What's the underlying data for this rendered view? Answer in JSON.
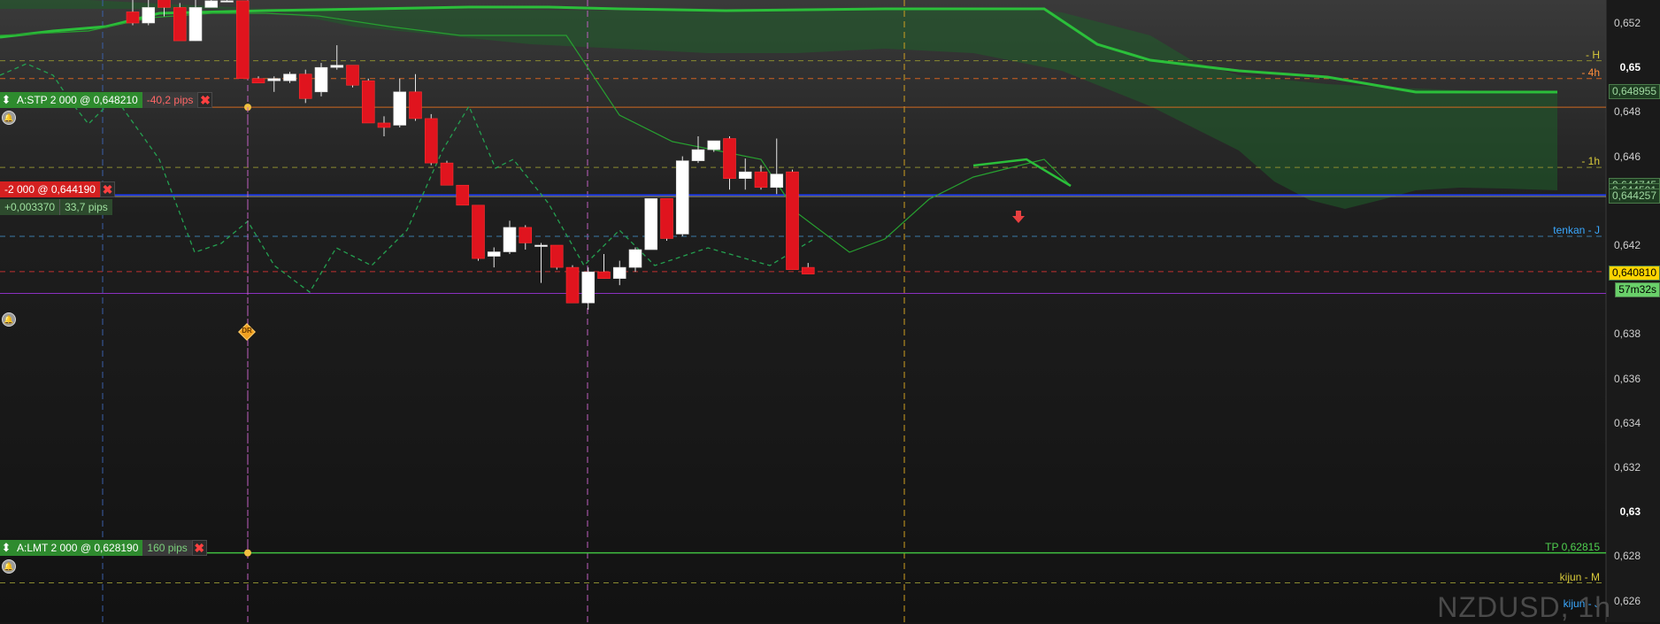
{
  "symbol_watermark": "NZDUSD, 1h",
  "price_axis": {
    "labels": [
      {
        "value": "0,652",
        "price": 0.652,
        "bold": false
      },
      {
        "value": "0,65",
        "price": 0.65,
        "bold": true
      },
      {
        "value": "0,648",
        "price": 0.648,
        "bold": false
      },
      {
        "value": "0,646",
        "price": 0.646,
        "bold": false
      },
      {
        "value": "0,642",
        "price": 0.642,
        "bold": false
      },
      {
        "value": "0,64",
        "price": 0.64,
        "bold": true
      },
      {
        "value": "0,638",
        "price": 0.638,
        "bold": false
      },
      {
        "value": "0,636",
        "price": 0.636,
        "bold": false
      },
      {
        "value": "0,634",
        "price": 0.634,
        "bold": false
      },
      {
        "value": "0,632",
        "price": 0.632,
        "bold": false
      },
      {
        "value": "0,63",
        "price": 0.63,
        "bold": true
      },
      {
        "value": "0,628",
        "price": 0.628,
        "bold": false
      },
      {
        "value": "0,626",
        "price": 0.626,
        "bold": false
      }
    ],
    "price_boxes": [
      {
        "text": "0,648955",
        "price": 0.648955,
        "bg": "#1f3d22",
        "fg": "#9fd8a0"
      },
      {
        "text": "0,644745",
        "price": 0.644745,
        "bg": "#1f3d22",
        "fg": "#9fd8a0"
      },
      {
        "text": "0,644501",
        "price": 0.6445,
        "bg": "#1f3d22",
        "fg": "#9fd8a0"
      },
      {
        "text": "0,644257",
        "price": 0.644257,
        "bg": "#1f3d22",
        "fg": "#9fd8a0"
      },
      {
        "text": "0,640810",
        "price": 0.64081,
        "bg": "#ffd400",
        "fg": "#000000"
      },
      {
        "text": "57m32s",
        "price": 0.64006,
        "bg": "#6ad06a",
        "fg": "#000000"
      }
    ]
  },
  "orders": [
    {
      "id": "stop",
      "label": "A:STP  2 000 @ 0,648210",
      "pips": "-40,2 pips",
      "pips_color": "#ff6666",
      "price": 0.64821,
      "label_bg": "#2e8b2e",
      "close": "✖"
    },
    {
      "id": "limit",
      "label": "A:LMT  2 000 @ 0,628190",
      "pips": "160 pips",
      "pips_color": "#7cd17c",
      "price": 0.62819,
      "label_bg": "#2e8b2e",
      "close": "✖"
    }
  ],
  "position": {
    "label": "-2 000 @ 0,644190",
    "pnl": "+0,003370",
    "pnl_pips": "33,7 pips",
    "price": 0.64419,
    "close": "✖"
  },
  "line_tags": [
    {
      "text": "- H",
      "price": 0.6503,
      "color": "#d8c93a"
    },
    {
      "text": "- 4h",
      "price": 0.6495,
      "color": "#ff8c3a"
    },
    {
      "text": "- 1h",
      "price": 0.6455,
      "color": "#d8c93a"
    },
    {
      "text": "tenkan - J",
      "price": 0.6424,
      "color": "#3aa8ff"
    },
    {
      "text": "TP 0,62815",
      "price": 0.62815,
      "color": "#4fd04f"
    },
    {
      "text": "kijun - M",
      "price": 0.6268,
      "color": "#d8c93a"
    },
    {
      "text": "kijun - J",
      "price": 0.6256,
      "color": "#3aa8ff"
    }
  ],
  "event_marker": {
    "text": "DR"
  },
  "chart_data": {
    "type": "candlestick",
    "symbol": "NZDUSD",
    "timeframe": "1h",
    "ylim": [
      0.6255,
      0.6531
    ],
    "candles": [
      {
        "o": 0.6525,
        "h": 0.6531,
        "l": 0.6519,
        "c": 0.652
      },
      {
        "o": 0.652,
        "h": 0.6531,
        "l": 0.6519,
        "c": 0.6527
      },
      {
        "o": 0.6531,
        "h": 0.6531,
        "l": 0.6523,
        "c": 0.6527
      },
      {
        "o": 0.6527,
        "h": 0.6529,
        "l": 0.6515,
        "c": 0.6512
      },
      {
        "o": 0.6512,
        "h": 0.6531,
        "l": 0.6512,
        "c": 0.6527
      },
      {
        "o": 0.6527,
        "h": 0.6531,
        "l": 0.6527,
        "c": 0.653
      },
      {
        "o": 0.653,
        "h": 0.6531,
        "l": 0.653,
        "c": 0.653
      },
      {
        "o": 0.653,
        "h": 0.653,
        "l": 0.6495,
        "c": 0.6495
      },
      {
        "o": 0.6495,
        "h": 0.6496,
        "l": 0.6493,
        "c": 0.6493
      },
      {
        "o": 0.6494,
        "h": 0.6496,
        "l": 0.6489,
        "c": 0.6495
      },
      {
        "o": 0.6494,
        "h": 0.6498,
        "l": 0.6493,
        "c": 0.6497
      },
      {
        "o": 0.6497,
        "h": 0.6499,
        "l": 0.6484,
        "c": 0.6486
      },
      {
        "o": 0.6489,
        "h": 0.6502,
        "l": 0.6487,
        "c": 0.65
      },
      {
        "o": 0.65,
        "h": 0.651,
        "l": 0.6499,
        "c": 0.6501
      },
      {
        "o": 0.6501,
        "h": 0.6501,
        "l": 0.6491,
        "c": 0.6492
      },
      {
        "o": 0.6494,
        "h": 0.6495,
        "l": 0.6478,
        "c": 0.6475
      },
      {
        "o": 0.6475,
        "h": 0.6478,
        "l": 0.6469,
        "c": 0.6473
      },
      {
        "o": 0.6474,
        "h": 0.6495,
        "l": 0.6473,
        "c": 0.6489
      },
      {
        "o": 0.6489,
        "h": 0.6497,
        "l": 0.6476,
        "c": 0.6477
      },
      {
        "o": 0.6477,
        "h": 0.6479,
        "l": 0.6456,
        "c": 0.6457
      },
      {
        "o": 0.6457,
        "h": 0.6458,
        "l": 0.6447,
        "c": 0.6447
      },
      {
        "o": 0.6447,
        "h": 0.6447,
        "l": 0.6438,
        "c": 0.6438
      },
      {
        "o": 0.6438,
        "h": 0.6438,
        "l": 0.6413,
        "c": 0.6414
      },
      {
        "o": 0.6415,
        "h": 0.6419,
        "l": 0.641,
        "c": 0.6417
      },
      {
        "o": 0.6417,
        "h": 0.6431,
        "l": 0.6416,
        "c": 0.6428
      },
      {
        "o": 0.6428,
        "h": 0.6429,
        "l": 0.6418,
        "c": 0.6421
      },
      {
        "o": 0.642,
        "h": 0.6421,
        "l": 0.6403,
        "c": 0.642
      },
      {
        "o": 0.642,
        "h": 0.642,
        "l": 0.6409,
        "c": 0.641
      },
      {
        "o": 0.641,
        "h": 0.6411,
        "l": 0.6394,
        "c": 0.6394
      },
      {
        "o": 0.6394,
        "h": 0.641,
        "l": 0.6391,
        "c": 0.6408
      },
      {
        "o": 0.6408,
        "h": 0.6416,
        "l": 0.6405,
        "c": 0.6405
      },
      {
        "o": 0.6405,
        "h": 0.6413,
        "l": 0.6402,
        "c": 0.641
      },
      {
        "o": 0.641,
        "h": 0.6419,
        "l": 0.6408,
        "c": 0.6418
      },
      {
        "o": 0.6418,
        "h": 0.6441,
        "l": 0.6418,
        "c": 0.6441
      },
      {
        "o": 0.6441,
        "h": 0.6441,
        "l": 0.6422,
        "c": 0.6423
      },
      {
        "o": 0.6425,
        "h": 0.646,
        "l": 0.6424,
        "c": 0.6458
      },
      {
        "o": 0.6458,
        "h": 0.6469,
        "l": 0.6457,
        "c": 0.6463
      },
      {
        "o": 0.6463,
        "h": 0.6467,
        "l": 0.6462,
        "c": 0.6467
      },
      {
        "o": 0.6468,
        "h": 0.6469,
        "l": 0.6445,
        "c": 0.645
      },
      {
        "o": 0.645,
        "h": 0.6459,
        "l": 0.6445,
        "c": 0.6453
      },
      {
        "o": 0.6453,
        "h": 0.6456,
        "l": 0.6445,
        "c": 0.6446
      },
      {
        "o": 0.6446,
        "h": 0.6468,
        "l": 0.6443,
        "c": 0.6452
      },
      {
        "o": 0.6453,
        "h": 0.6454,
        "l": 0.6409,
        "c": 0.6409
      },
      {
        "o": 0.641,
        "h": 0.6412,
        "l": 0.6407,
        "c": 0.6407
      }
    ],
    "horizontal_lines": {
      "stop_order": 0.64821,
      "position_entry": 0.64419,
      "limit_order": 0.62815,
      "blue_level": 0.64426,
      "purple_level": 0.63983,
      "current_price": 0.64081
    }
  }
}
